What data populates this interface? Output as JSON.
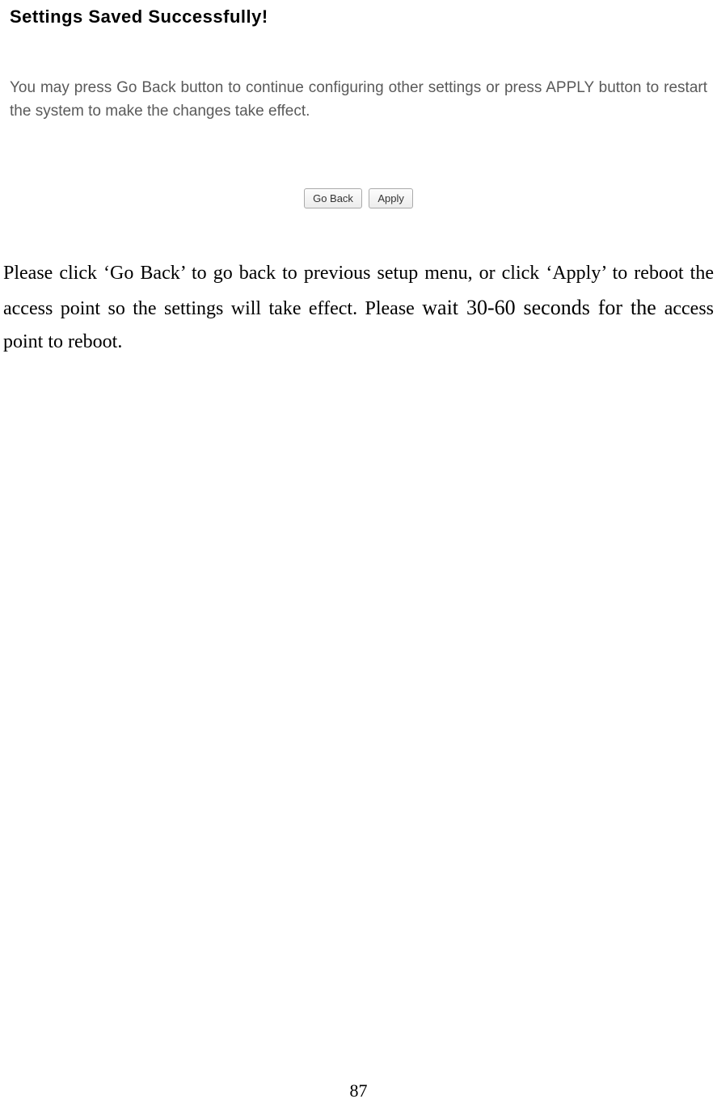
{
  "screenshot": {
    "title": "Settings Saved Successfully!",
    "info_text": "You may press Go Back button to continue configuring other settings or press APPLY button to restart the system to make the changes take effect.",
    "go_back_label": "Go Back",
    "apply_label": "Apply"
  },
  "doc_paragraph": {
    "part1": "Please click ‘Go Back’ to go back to previous setup menu, or click ‘Apply’ to reboot the access point so the settings will take effect. Please ",
    "part2_emph": "wait 30-60 seconds for the ",
    "part3": "access point to reboot."
  },
  "page_number": "87"
}
